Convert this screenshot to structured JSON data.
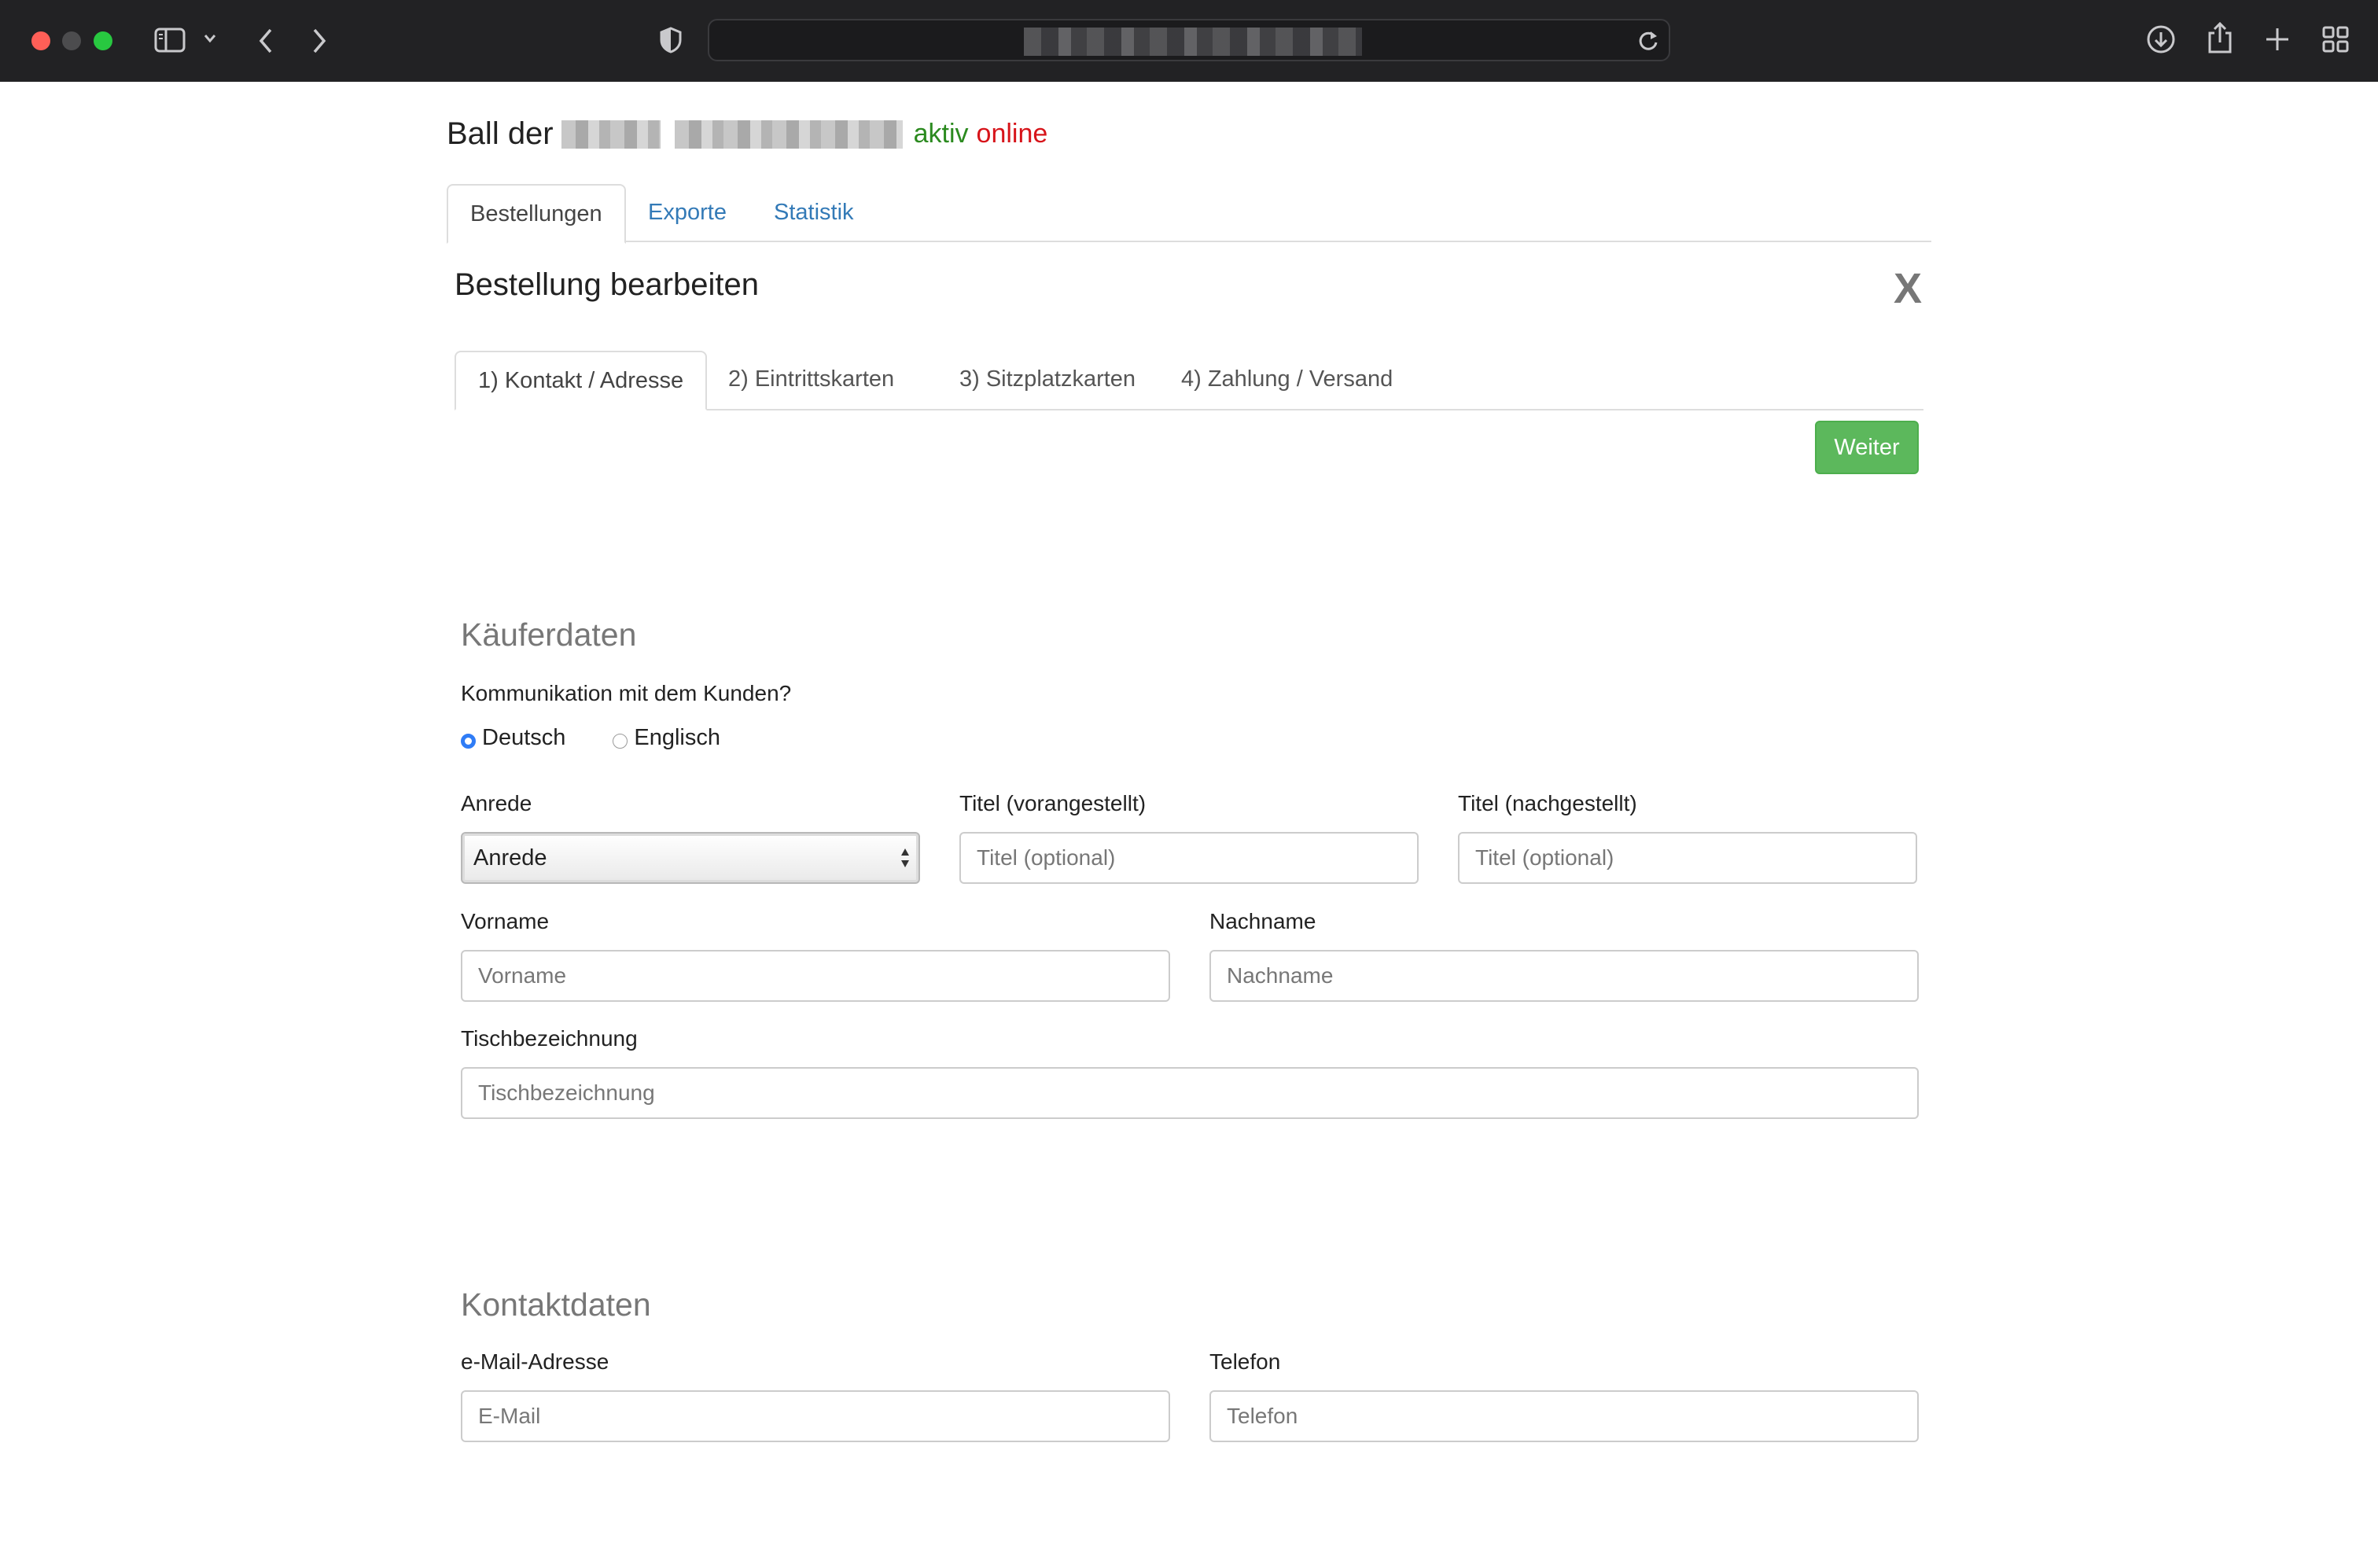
{
  "browser": {
    "icons": [
      "sidebar-icon",
      "chevron-down-icon",
      "back-icon",
      "forward-icon",
      "shield-icon",
      "reload-icon",
      "download-icon",
      "share-icon",
      "plus-icon",
      "tabs-overview-icon"
    ]
  },
  "header": {
    "title_prefix": "Ball der",
    "status_active": "aktiv",
    "status_online": "online"
  },
  "main_tabs": [
    {
      "label": "Bestellungen",
      "active": true
    },
    {
      "label": "Exporte",
      "active": false
    },
    {
      "label": "Statistik",
      "active": false
    }
  ],
  "panel": {
    "title": "Bestellung bearbeiten",
    "close_label": "X"
  },
  "steps": [
    {
      "label": "1) Kontakt / Adresse",
      "active": true
    },
    {
      "label": "2) Eintrittskarten",
      "active": false
    },
    {
      "label": "3) Sitzplatzkarten",
      "active": false
    },
    {
      "label": "4) Zahlung / Versand",
      "active": false
    }
  ],
  "actions": {
    "next_label": "Weiter"
  },
  "buyer": {
    "heading": "Käuferdaten",
    "communication_label": "Kommunikation mit dem Kunden?",
    "lang_de": "Deutsch",
    "lang_en": "Englisch",
    "selected_language": "Deutsch",
    "salutation_label": "Anrede",
    "salutation_value": "Anrede",
    "title_pre_label": "Titel (vorangestellt)",
    "title_pre_placeholder": "Titel (optional)",
    "title_post_label": "Titel (nachgestellt)",
    "title_post_placeholder": "Titel (optional)",
    "first_name_label": "Vorname",
    "first_name_placeholder": "Vorname",
    "last_name_label": "Nachname",
    "last_name_placeholder": "Nachname",
    "table_label": "Tischbezeichnung",
    "table_placeholder": "Tischbezeichnung"
  },
  "contact": {
    "heading": "Kontaktdaten",
    "email_label": "e-Mail-Adresse",
    "email_placeholder": "E-Mail",
    "phone_label": "Telefon",
    "phone_placeholder": "Telefon"
  },
  "colors": {
    "chrome_bg": "#222224",
    "link_blue": "#337ab7",
    "success_green": "#5cb85c",
    "status_active": "#2b8a1f",
    "status_online": "#d7141a",
    "radio_blue": "#2f7cf6"
  }
}
